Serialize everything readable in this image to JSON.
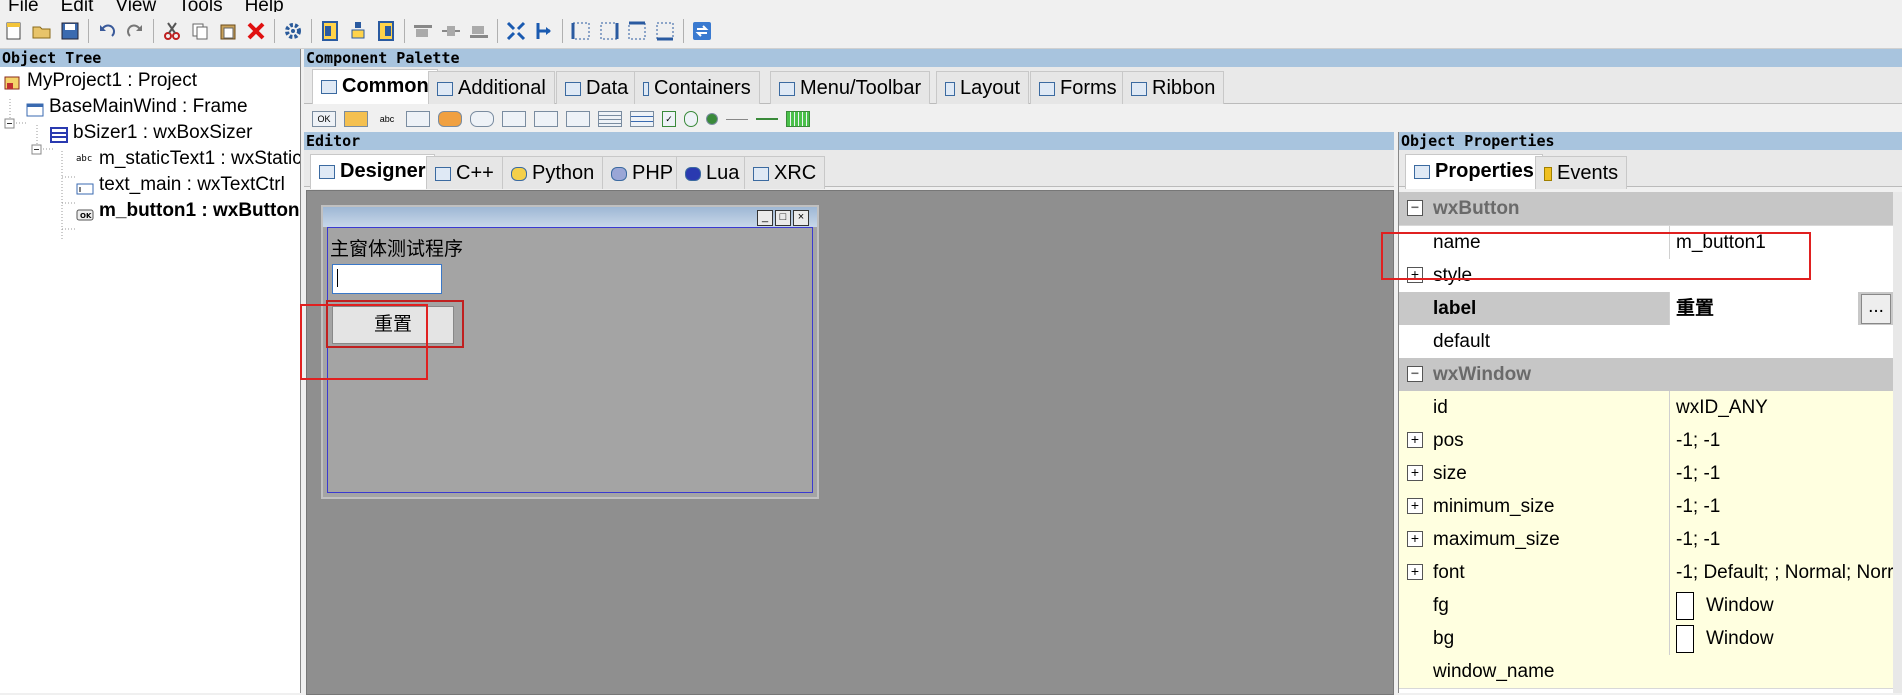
{
  "menu": {
    "items": [
      "File",
      "Edit",
      "View",
      "Tools",
      "Help"
    ]
  },
  "toolbar": {
    "icons": [
      "new-file-icon",
      "open-icon",
      "save-icon",
      "undo-icon",
      "redo-icon",
      "cut-icon",
      "copy-icon",
      "paste-icon",
      "delete-icon",
      "settings-icon",
      "align-left-icon",
      "align-center-icon",
      "align-right-icon",
      "expand-icon",
      "stretch-icon",
      "border-left-icon",
      "border-right-icon",
      "border-top-icon",
      "border-bottom-icon",
      "refresh-icon"
    ]
  },
  "object_tree": {
    "title": "Object Tree",
    "items": [
      {
        "label": "MyProject1 : Project"
      },
      {
        "label": "BaseMainWind : Frame"
      },
      {
        "label": "bSizer1 : wxBoxSizer"
      },
      {
        "label": "m_staticText1 : wxStatic"
      },
      {
        "label": "text_main : wxTextCtrl"
      },
      {
        "label": "m_button1 : wxButton"
      }
    ]
  },
  "palette": {
    "title": "Component Palette",
    "tabs": [
      {
        "label": "Common"
      },
      {
        "label": "Additional"
      },
      {
        "label": "Data"
      },
      {
        "label": "Containers"
      },
      {
        "label": "Menu/Toolbar"
      },
      {
        "label": "Layout"
      },
      {
        "label": "Forms"
      },
      {
        "label": "Ribbon"
      }
    ],
    "widget_labels": {
      "button": "OK",
      "static": "abc"
    }
  },
  "editor": {
    "title": "Editor",
    "tabs": [
      {
        "label": "Designer"
      },
      {
        "label": "C++"
      },
      {
        "label": "Python"
      },
      {
        "label": "PHP"
      },
      {
        "label": "Lua"
      },
      {
        "label": "XRC"
      }
    ],
    "frame": {
      "static_text": "主窗体测试程序",
      "text_value": "",
      "button_label": "重置",
      "title_buttons": [
        "_",
        "□",
        "×"
      ]
    }
  },
  "properties": {
    "title": "Object Properties",
    "tabs": [
      {
        "label": "Properties"
      },
      {
        "label": "Events"
      }
    ],
    "rows": [
      {
        "type": "cat",
        "name": "wxButton"
      },
      {
        "type": "white",
        "name": "name",
        "value": "m_button1"
      },
      {
        "type": "white",
        "name": "style",
        "value": "",
        "expand": true
      },
      {
        "type": "label",
        "name": "label",
        "value": "重置",
        "ellipsis": "..."
      },
      {
        "type": "white",
        "name": "default",
        "value": "",
        "checkbox": true
      },
      {
        "type": "cat",
        "name": "wxWindow"
      },
      {
        "type": "yel",
        "name": "id",
        "value": "wxID_ANY"
      },
      {
        "type": "yel",
        "name": "pos",
        "value": "-1; -1",
        "expand": true
      },
      {
        "type": "yel",
        "name": "size",
        "value": "-1; -1",
        "expand": true
      },
      {
        "type": "yel",
        "name": "minimum_size",
        "value": "-1; -1",
        "expand": true
      },
      {
        "type": "yel",
        "name": "maximum_size",
        "value": "-1; -1",
        "expand": true
      },
      {
        "type": "yel",
        "name": "font",
        "value": "-1; Default; ; Normal; Norr",
        "expand": true
      },
      {
        "type": "yel",
        "name": "fg",
        "value": "Window",
        "color": true
      },
      {
        "type": "yel",
        "name": "bg",
        "value": "Window",
        "color": true
      },
      {
        "type": "yel",
        "name": "window_name",
        "value": ""
      }
    ]
  },
  "colors": {
    "accent": "#e02020",
    "header": "#a8c4de",
    "property_bg": "#ffffe0"
  }
}
